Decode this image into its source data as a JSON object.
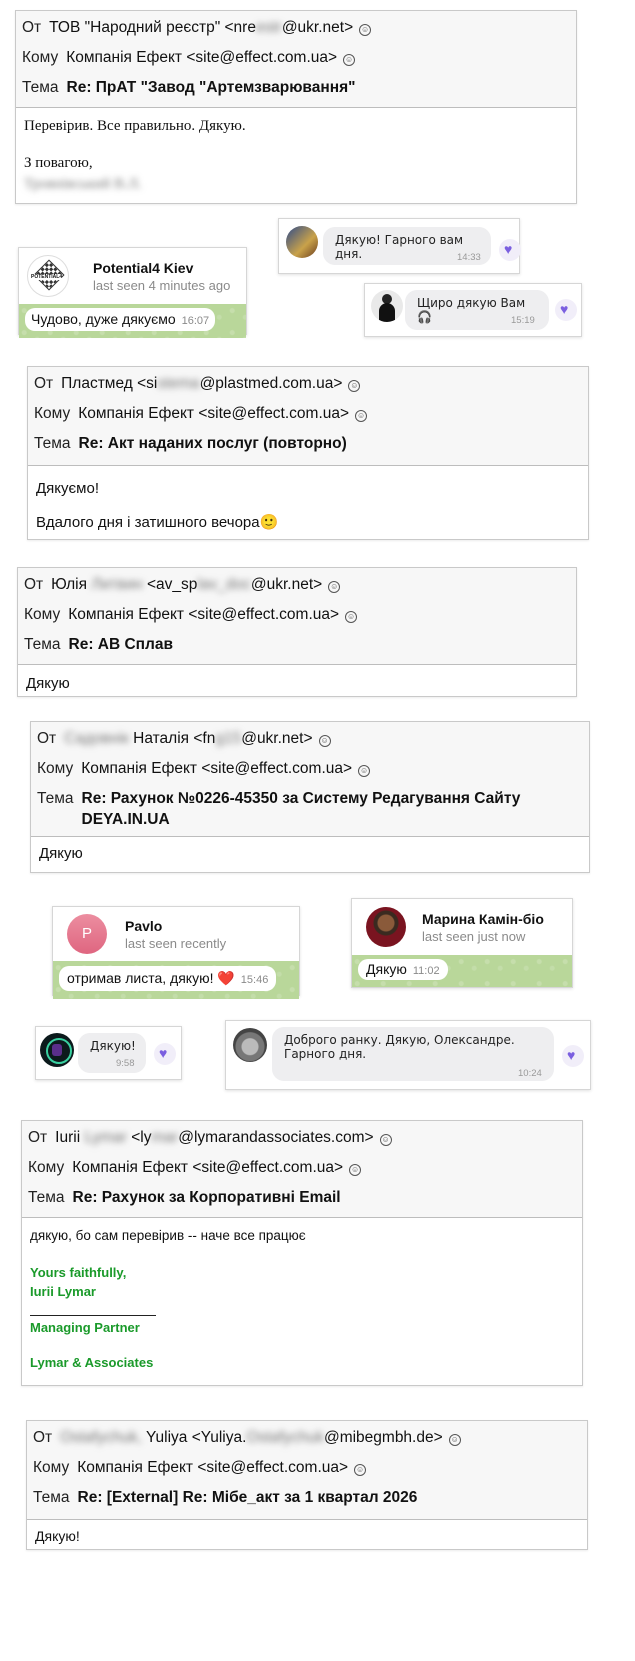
{
  "labels": {
    "from": "От",
    "to": "Кому",
    "subject": "Тема"
  },
  "email1": {
    "from_name": "ТОВ \"Народний реєстр\" <nre",
    "from_blur": "estr",
    "from_tail": "@ukr.net>",
    "to": "Компанія Ефект <site@effect.com.ua>",
    "subject": "Re: ПрАТ \"Завод \"Артемзварювання\"",
    "body_line1": "Перевірив. Все правильно. Дякую.",
    "body_line2": "З повагою,",
    "body_blur": "Троянівський В.Л."
  },
  "viber1": {
    "text": "Дякую! Гарного вам дня.",
    "time": "14:33"
  },
  "tg1": {
    "name": "Potential4 Kiev",
    "seen": "last seen 4 minutes ago",
    "msg": "Чудово, дуже дякуємо",
    "time": "16:07",
    "logo_text": "POTENTIAL4"
  },
  "viber2": {
    "text": "Щиро дякую Вам 🎧",
    "time": "15:19"
  },
  "email2": {
    "from_name": "Пластмед <si",
    "from_blur": "stema",
    "from_tail": "@plastmed.com.ua>",
    "to": "Компанія Ефект <site@effect.com.ua>",
    "subject": "Re: Акт наданих послуг (повторно)",
    "body_line1": "Дякуємо!",
    "body_line2": "Вдалого дня і затишного вечора🙂"
  },
  "email3": {
    "from_name": "Юлія ",
    "from_blur": "Литвин",
    "from_mid": " <av_sp",
    "from_blur2": "lav_doc",
    "from_tail": "@ukr.net>",
    "to": "Компанія Ефект <site@effect.com.ua>",
    "subject": "Re: АВ Сплав",
    "body_line1": "Дякую"
  },
  "email4": {
    "from_blur": "Садовнік",
    "from_name": " Наталія <fn",
    "from_blur2": "g15",
    "from_tail": "@ukr.net>",
    "to": "Компанія Ефект <site@effect.com.ua>",
    "subject_line1": "Re: Рахунок №0226-45350 за Систему Редагування Сайту",
    "subject_line2": "DEYA.IN.UA",
    "body_line1": "Дякую"
  },
  "tg2": {
    "initial": "P",
    "name": "Pavlo",
    "seen": "last seen recently",
    "msg": "отримав листа, дякую! ❤️",
    "time": "15:46"
  },
  "tg3": {
    "name": "Марина Камін-біо",
    "seen": "last seen just now",
    "msg": "Дякую",
    "time": "11:02"
  },
  "viber3": {
    "text": "Дякую!",
    "time": "9:58"
  },
  "viber4": {
    "text_line1": "Доброго ранку. Дякую, Олександре.",
    "text_line2": "Гарного дня.",
    "time": "10:24"
  },
  "email5": {
    "from_name": "Iurii ",
    "from_blur": "Lymar",
    "from_mid": " <ly",
    "from_blur2": "mar",
    "from_tail": "@lymarandassociates.com>",
    "to": "Компанія Ефект <site@effect.com.ua>",
    "subject": "Re: Рахунок за Корпоративні Email",
    "body_line1": "дякую, бо сам перевірив  -- наче все працює",
    "sig1": "Yours faithfully,",
    "sig2": "Iurii Lymar",
    "sig3": "Managing Partner",
    "sig4": "Lymar & Associates"
  },
  "email6": {
    "from_blur": "Ostafychuk,",
    "from_name": " Yuliya <Yuliya.",
    "from_blur2": "Ostafychuk",
    "from_tail": "@mibegmbh.de>",
    "to": "Компанія Ефект <site@effect.com.ua>",
    "subject": "Re: [External] Re: Мібе_акт за 1 квартал 2026",
    "body_line1": "Дякую!"
  },
  "colors": {
    "accent_heart": "#7b5fe0",
    "tg_chat_bg": "#b9d79a",
    "signature_green": "#1a9a2a",
    "pavlo_avatar": "#e7738a"
  }
}
